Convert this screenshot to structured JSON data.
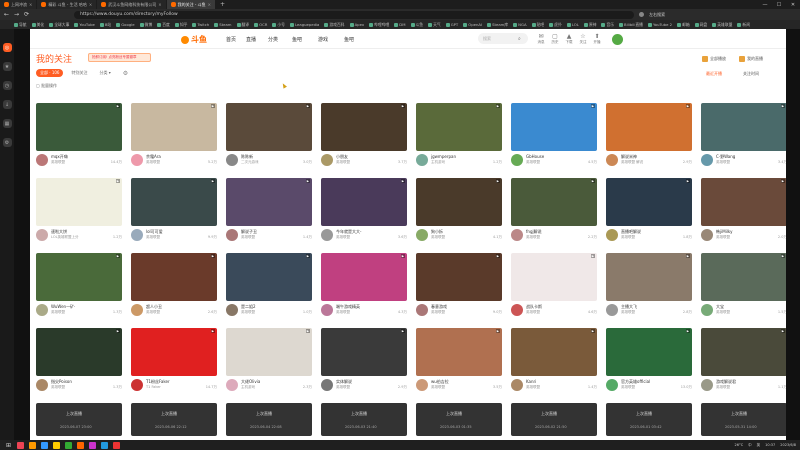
{
  "browser": {
    "tabs": [
      {
        "label": "上网冲浪",
        "active": false
      },
      {
        "label": "精彩 斗鱼 - 生活 哈哈",
        "active": false
      },
      {
        "label": "武汉斗鱼网络科技有限公司",
        "active": false
      },
      {
        "label": "我的关注 - 斗鱼",
        "active": true
      }
    ],
    "new_tab": "+",
    "url": "https://www.douyu.com/directory/myFollow",
    "bookmarks": [
      "导航",
      "美化",
      "全球大事",
      "YouTube",
      "B站",
      "Google",
      "微博",
      "百度",
      "知乎",
      "Twitch",
      "Steam",
      "翻译",
      "OCR",
      "小号",
      "Leaguepedia",
      "游戏百科",
      "Apex",
      "哔哩哔哩",
      "DM",
      "斗鱼",
      "天气",
      "GPT",
      "OpenAI",
      "Steam库",
      "NGA",
      "贴吧",
      "虎扑",
      "LOL",
      "原神",
      "音乐",
      "Bilibili直播",
      "YouTube 2",
      "邮箱",
      "网盘",
      "英雄联盟",
      "新闻"
    ],
    "right_note": "左右搜索",
    "window_controls": [
      "—",
      "☐",
      "✕"
    ]
  },
  "sidebar_icons": [
    "browser-icon",
    "star-icon",
    "history-icon",
    "download-icon",
    "apps-icon",
    "settings-icon"
  ],
  "site": {
    "logo_text": "斗鱼",
    "nav": [
      "首页",
      "直播",
      "分类",
      "鱼吧",
      "游戏",
      "鱼吧"
    ],
    "search_placeholder": "搜索",
    "header_icons": [
      {
        "glyph": "✉",
        "label": "消息"
      },
      {
        "glyph": "▢",
        "label": "历史"
      },
      {
        "glyph": "▲",
        "label": "下载"
      },
      {
        "glyph": "☆",
        "label": "关注"
      },
      {
        "glyph": "⬆",
        "label": "开播"
      }
    ]
  },
  "page": {
    "title": "我的关注",
    "banner": "抢鲜订阅! 点亮粉丝专属徽章",
    "filters": [
      {
        "label": "全部 · 106",
        "on": true
      },
      {
        "label": "特别关注",
        "on": false
      },
      {
        "label": "分类 ▾",
        "on": false
      }
    ],
    "batch_label": "批量操作",
    "hdr_buttons": [
      "全部播放",
      "我的直播"
    ],
    "sort_options": [
      {
        "label": "最近开播",
        "on": true
      },
      {
        "label": "关注时间",
        "on": false
      }
    ]
  },
  "cards": [
    {
      "name": "mqx开嗨",
      "sub": "英雄联盟",
      "views": "14.4万",
      "color": "#3a5a3a",
      "av": "#b77"
    },
    {
      "name": "余霜Ara",
      "sub": "英雄联盟",
      "views": "5.2万",
      "color": "#c8b8a0",
      "av": "#e9a"
    },
    {
      "name": "陈陈新",
      "sub": "二次元游戏",
      "views": "3.0万",
      "color": "#5a4a3a",
      "av": "#888"
    },
    {
      "name": "小朋友",
      "sub": "英雄联盟",
      "views": "3.7万",
      "color": "#4a3a2a",
      "av": "#a96"
    },
    {
      "name": "jgwmperpan",
      "sub": "主机游戏",
      "views": "1.2万",
      "color": "#5a6a3a",
      "av": "#7a9"
    },
    {
      "name": "GbHouse",
      "sub": "英雄联盟",
      "views": "4.5万",
      "color": "#3a8ad0",
      "av": "#6a5"
    },
    {
      "name": "解说米神",
      "sub": "英雄联盟 解说",
      "views": "2.9万",
      "color": "#d07030",
      "av": "#c85"
    },
    {
      "name": "C·野Wang",
      "sub": "英雄联盟",
      "views": "3.4万",
      "color": "#4a6a6a",
      "av": "#69a"
    },
    {
      "name": "速啦大饼",
      "sub": "LOL英雄联盟上分",
      "views": "1.2万",
      "color": "#f0efe0",
      "av": "#caa"
    },
    {
      "name": "lol可可爱",
      "sub": "英雄联盟",
      "views": "9.9万",
      "color": "#3a4a4a",
      "av": "#9ab"
    },
    {
      "name": "解说子丑",
      "sub": "英雄联盟",
      "views": "1.4万",
      "color": "#5a4a6a",
      "av": "#a77"
    },
    {
      "name": "今年就是大大-",
      "sub": "英雄联盟",
      "views": "3.6万",
      "color": "#4a3a5a",
      "av": "#999"
    },
    {
      "name": "狗小拆",
      "sub": "英雄联盟",
      "views": "4.1万",
      "color": "#4a3a2a",
      "av": "#8a6"
    },
    {
      "name": "fngj解说",
      "sub": "英雄联盟",
      "views": "2.2万",
      "color": "#4a5a3a",
      "av": "#b88"
    },
    {
      "name": "直播吧解说",
      "sub": "英雄联盟",
      "views": "1.8万",
      "color": "#2a3a4a",
      "av": "#a95"
    },
    {
      "name": "韩jiMilky",
      "sub": "英雄联盟",
      "views": "2.0万",
      "color": "#6a4a3a",
      "av": "#987"
    },
    {
      "name": "WuWen一矿·",
      "sub": "英雄联盟",
      "views": "1.3万",
      "color": "#4a6a3a",
      "av": "#aa8"
    },
    {
      "name": "超人小丑",
      "sub": "英雄联盟",
      "views": "2.6万",
      "color": "#6a3a2a",
      "av": "#c96"
    },
    {
      "name": "是二姐2",
      "sub": "英雄联盟",
      "views": "1.0万",
      "color": "#3a4a5a",
      "av": "#876"
    },
    {
      "name": "端午游戏精英",
      "sub": "英雄联盟",
      "views": "4.3万",
      "color": "#c04080",
      "av": "#b79"
    },
    {
      "name": "春意游戏",
      "sub": "英雄联盟",
      "views": "9.0万",
      "color": "#5a3a2a",
      "av": "#a77"
    },
    {
      "name": "战队卡斯",
      "sub": "英雄联盟",
      "views": "4.6万",
      "color": "#f0e8e8",
      "av": "#c55"
    },
    {
      "name": "主播大飞",
      "sub": "英雄联盟",
      "views": "2.8万",
      "color": "#8a7a6a",
      "av": "#999"
    },
    {
      "name": "大宝",
      "sub": "英雄联盟",
      "views": "1.5万",
      "color": "#5a6a5a",
      "av": "#7a7"
    },
    {
      "name": "指尖Poison",
      "sub": "英雄联盟",
      "views": "1.3万",
      "color": "#2a3a2a",
      "av": "#a86"
    },
    {
      "name": "T1粉丝Faker",
      "sub": "T1 Faker",
      "views": "14.7万",
      "color": "#e02020",
      "av": "#c33"
    },
    {
      "name": "大佬Olivia",
      "sub": "主机游戏",
      "views": "2.3万",
      "color": "#ddd8d0",
      "av": "#dab"
    },
    {
      "name": "实体解说",
      "sub": "英雄联盟",
      "views": "2.9万",
      "color": "#3a3a3a",
      "av": "#777"
    },
    {
      "name": "wu伯吉拉",
      "sub": "英雄联盟",
      "views": "3.5万",
      "color": "#b07050",
      "av": "#c97"
    },
    {
      "name": "Kanri",
      "sub": "英雄联盟",
      "views": "1.4万",
      "color": "#7a5a3a",
      "av": "#a86"
    },
    {
      "name": "官方英雄official",
      "sub": "英雄联盟",
      "views": "13.0万",
      "color": "#2a6a3a",
      "av": "#5a6"
    },
    {
      "name": "游戏解说君",
      "sub": "英雄联盟",
      "views": "1.1万",
      "color": "#4a4a3a",
      "av": "#998"
    }
  ],
  "offline": [
    {
      "label": "上次直播",
      "date": "2023-06-07 23:00"
    },
    {
      "label": "上次直播",
      "date": "2023-06-06 22:12"
    },
    {
      "label": "上次直播",
      "date": "2023-06-04 22:08"
    },
    {
      "label": "上次直播",
      "date": "2023-06-03 21:40"
    },
    {
      "label": "上次直播",
      "date": "2023-06-03 01:35"
    },
    {
      "label": "上次直播",
      "date": "2023-06-02 21:50"
    },
    {
      "label": "上次直播",
      "date": "2023-06-01 03:42"
    },
    {
      "label": "上次直播",
      "date": "2023-05-31 14:00"
    }
  ],
  "taskbar": {
    "app_colors": [
      "#e45",
      "#f90",
      "#39f",
      "#fc0",
      "#3a3",
      "#f60",
      "#c3c",
      "#29d",
      "#e33"
    ],
    "tray": [
      "26°C",
      "中",
      "英",
      "10:37",
      "2023/6/8"
    ]
  }
}
